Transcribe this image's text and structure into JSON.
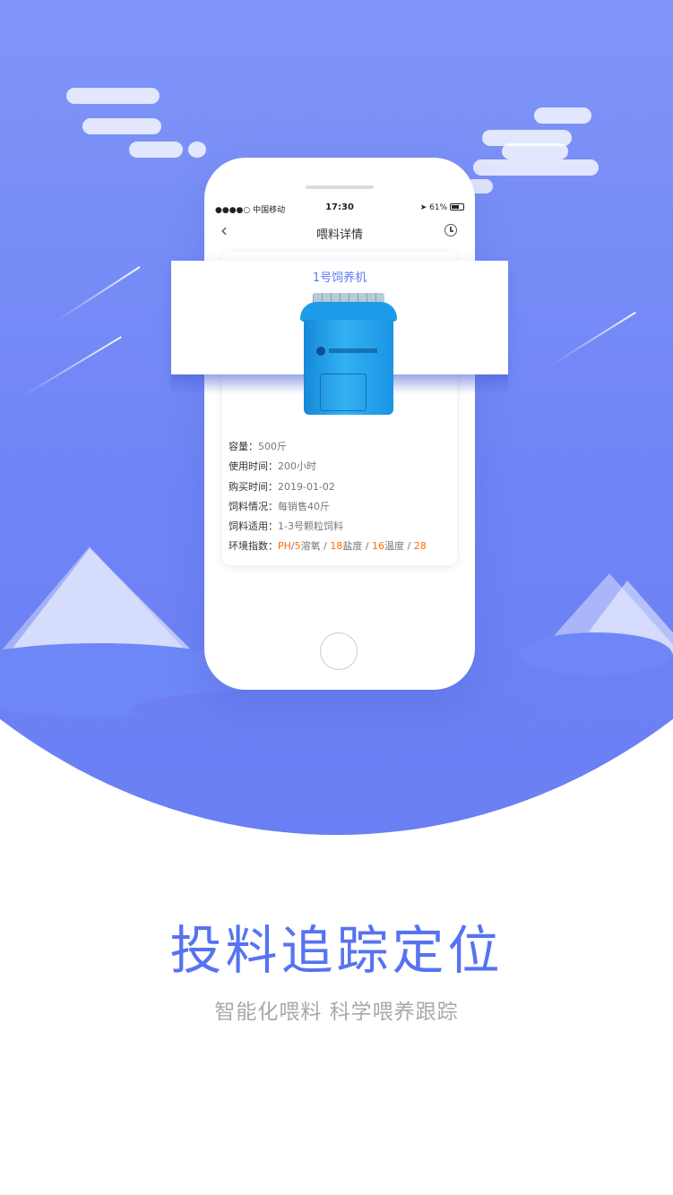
{
  "phone": {
    "status": {
      "carrier": "●●●●○ 中国移动",
      "time": "17:30",
      "battery": "61%"
    },
    "nav": {
      "title": "喂料详情"
    },
    "card": {
      "device_name": "1号饲养机",
      "rows": [
        {
          "key": "容量：",
          "value": "500斤"
        },
        {
          "key": "使用时间：",
          "value": "200小时"
        },
        {
          "key": "购买时间：",
          "value": "2019-01-02"
        },
        {
          "key": "饲料情况：",
          "value": "每销售40斤"
        },
        {
          "key": "饲料适用：",
          "value": "1-3号颗粒饲料"
        }
      ],
      "env": {
        "key": "环境指数：",
        "ph_label": "PH",
        "sep1": "/",
        "ph_value": "5",
        "oxygen_label": "溶氧",
        "sep2": " / ",
        "oxygen_value": "18",
        "salinity_label": "盐度",
        "sep3": " / ",
        "salinity_value": "16",
        "temp_label": "温度",
        "sep4": " / ",
        "temp_value": "28"
      }
    }
  },
  "headline": "投料追踪定位",
  "subtitle": "智能化喂料 科学喂养跟踪",
  "colors": {
    "accent": "#5773f2",
    "highlight": "#ff6a00"
  }
}
